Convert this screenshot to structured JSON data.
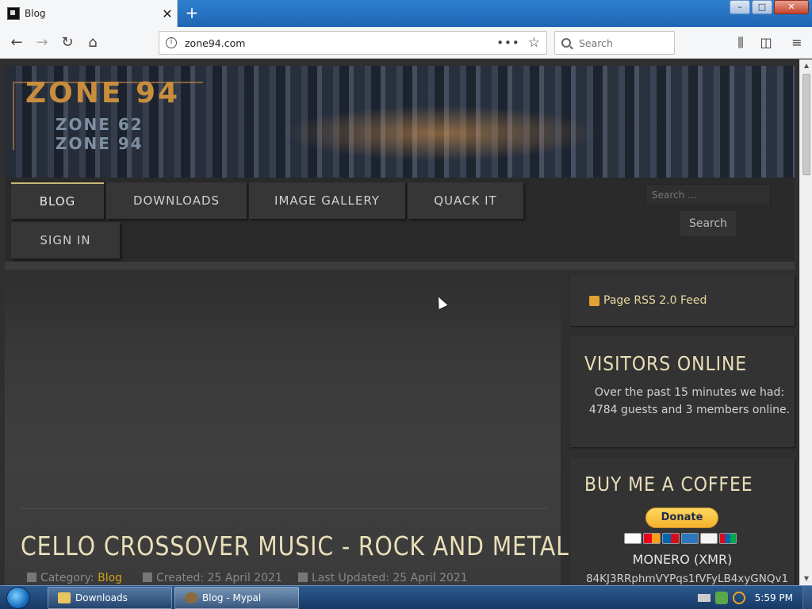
{
  "browser": {
    "tab_title": "Blog",
    "new_tab": "+",
    "close_tab": "✕",
    "url": "zone94.com",
    "url_menu": "•••",
    "search_placeholder": "Search"
  },
  "banner": {
    "logo": "ZONE 94",
    "sub_line1": "ZONE 62",
    "sub_line2": "ZONE 94"
  },
  "menu": {
    "items": [
      "BLOG",
      "DOWNLOADS",
      "IMAGE GALLERY",
      "QUACK IT",
      "SIGN IN"
    ],
    "search_placeholder": "Search ...",
    "search_button": "Search"
  },
  "article": {
    "title": "CELLO CROSSOVER MUSIC - ROCK AND METAL",
    "category_label": "Category:",
    "category": "Blog",
    "created": "Created: 25 April 2021",
    "updated": "Last Updated: 25 April 2021"
  },
  "sidebar": {
    "rss": "Page RSS 2.0 Feed",
    "visitors_heading": "VISITORS ONLINE",
    "visitors_text": "Over the past 15 minutes we had: 4784 guests and 3 members online.",
    "coffee_heading": "BUY ME A COFFEE",
    "donate": "Donate",
    "monero": "MONERO (XMR)",
    "address": "84KJ3RRphmVYPqs1fVFyLB4xyGNQv1"
  },
  "taskbar": {
    "task1": "Downloads",
    "task2": "Blog - Mypal",
    "clock": "5:59 PM"
  },
  "colors": {
    "accent_gold": "#e9dfb8",
    "link_orange": "#d4a017",
    "page_bg": "#2f2f2f"
  }
}
